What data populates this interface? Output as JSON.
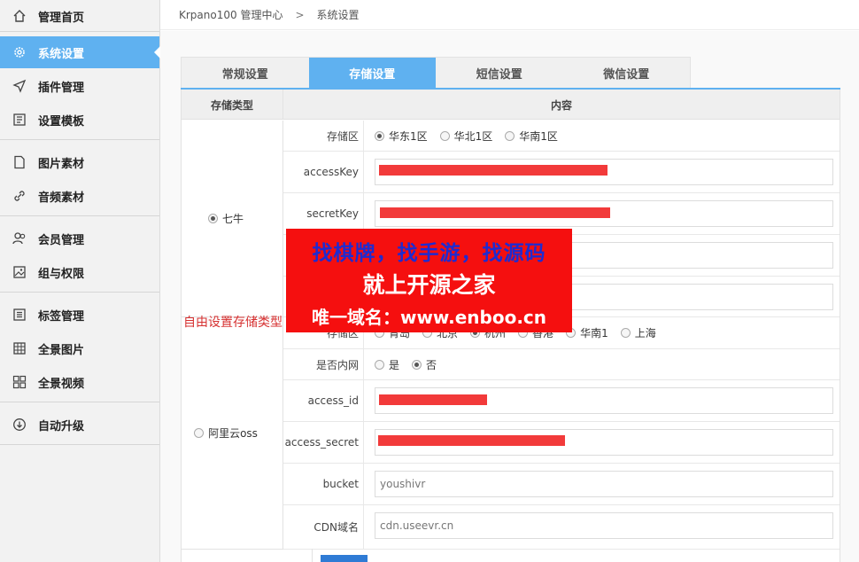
{
  "sidebar": {
    "items": [
      {
        "label": "管理首页",
        "icon": "home-icon"
      },
      {
        "label": "系统设置",
        "icon": "gear-icon"
      },
      {
        "label": "插件管理",
        "icon": "send-icon"
      },
      {
        "label": "设置模板",
        "icon": "template-icon"
      },
      {
        "label": "图片素材",
        "icon": "document-icon"
      },
      {
        "label": "音频素材",
        "icon": "link-icon"
      },
      {
        "label": "会员管理",
        "icon": "users-icon"
      },
      {
        "label": "组与权限",
        "icon": "image-icon"
      },
      {
        "label": "标签管理",
        "icon": "list-icon"
      },
      {
        "label": "全景图片",
        "icon": "grid-icon"
      },
      {
        "label": "全景视频",
        "icon": "apps-icon"
      },
      {
        "label": "自动升级",
        "icon": "download-circle-icon"
      }
    ]
  },
  "breadcrumb": {
    "root": "Krpano100 管理中心",
    "separator": ">",
    "current": "系统设置"
  },
  "tabs": [
    {
      "label": "常规设置"
    },
    {
      "label": "存储设置"
    },
    {
      "label": "短信设置"
    },
    {
      "label": "微信设置"
    }
  ],
  "table": {
    "col_type": "存储类型",
    "col_content": "内容",
    "qiniu": {
      "type_label": "七牛",
      "region_label": "存储区",
      "regions": [
        "华东1区",
        "华北1区",
        "华南1区"
      ],
      "access_key_label": "accessKey",
      "secret_key_label": "secretKey"
    },
    "aliyun": {
      "type_label": "阿里云oss",
      "region_label": "存储区",
      "regions": [
        "青岛",
        "北京",
        "杭州",
        "香港",
        "华南1",
        "上海"
      ],
      "intranet_label": "是否内网",
      "intranet_options": [
        "是",
        "否"
      ],
      "access_id_label": "access_id",
      "access_secret_label": "access_secret",
      "bucket_label": "bucket",
      "bucket_value": "youshivr",
      "cdn_label": "CDN域名",
      "cdn_value": "cdn.useevr.cn"
    }
  },
  "overlay": {
    "line1": "找棋牌，找手游，找源码",
    "line2": "就上开源之家",
    "line3": "唯一域名：www.enboo.cn"
  },
  "hint_text": "自由设置存储类型",
  "colors": {
    "accent": "#5fb1f0",
    "redaction": "#f23a3a",
    "banner": "#f50f0f"
  }
}
